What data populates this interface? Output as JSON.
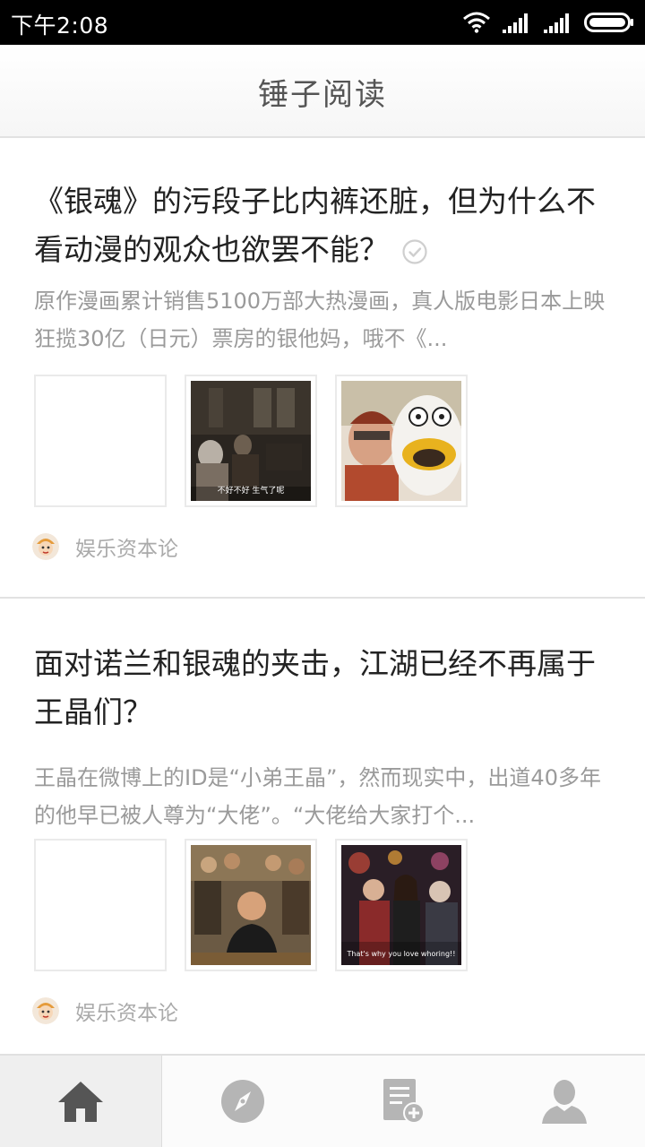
{
  "status_bar": {
    "time": "下午2:08",
    "icons": [
      "wifi-icon",
      "signal-icon",
      "signal-icon",
      "battery-icon"
    ]
  },
  "header": {
    "title": "锤子阅读"
  },
  "articles": [
    {
      "title": "《银魂》的污段子比内裤还脏，但为什么不看动漫的观众也欲罢不能？",
      "read_marker": "check-circle-icon",
      "summary": "原作漫画累计销售5100万部大热漫画，真人版电影日本上映狂揽30亿（日元）票房的银他妈，哦不《...",
      "thumbnails": [
        {
          "kind": "blank",
          "caption": ""
        },
        {
          "kind": "dark-scene",
          "caption": "不好不好 生气了呢"
        },
        {
          "kind": "mascot",
          "caption": ""
        }
      ],
      "source": "娱乐资本论"
    },
    {
      "title": "面对诺兰和银魂的夹击，江湖已经不再属于王晶们？",
      "summary": "王晶在微博上的ID是“小弟王晶”，然而现实中，出道40多年的他早已被人尊为“大佬”。“大佬给大家打个...",
      "thumbnails": [
        {
          "kind": "blank",
          "caption": ""
        },
        {
          "kind": "poster",
          "caption": ""
        },
        {
          "kind": "street-scene",
          "caption": "That's why you love whoring!!"
        }
      ],
      "source": "娱乐资本论"
    }
  ],
  "bottom_nav": [
    {
      "name": "home",
      "icon": "home-icon",
      "active": true
    },
    {
      "name": "discover",
      "icon": "compass-icon",
      "active": false
    },
    {
      "name": "subscribe",
      "icon": "add-document-icon",
      "active": false
    },
    {
      "name": "profile",
      "icon": "user-icon",
      "active": false
    }
  ],
  "colors": {
    "status_bar_bg": "#000000",
    "title_text": "#555555",
    "article_title": "#222222",
    "summary_text": "#9a9a9a",
    "source_text": "#aaaaaa",
    "nav_icon": "#b5b5b5",
    "nav_icon_active": "#555555"
  }
}
